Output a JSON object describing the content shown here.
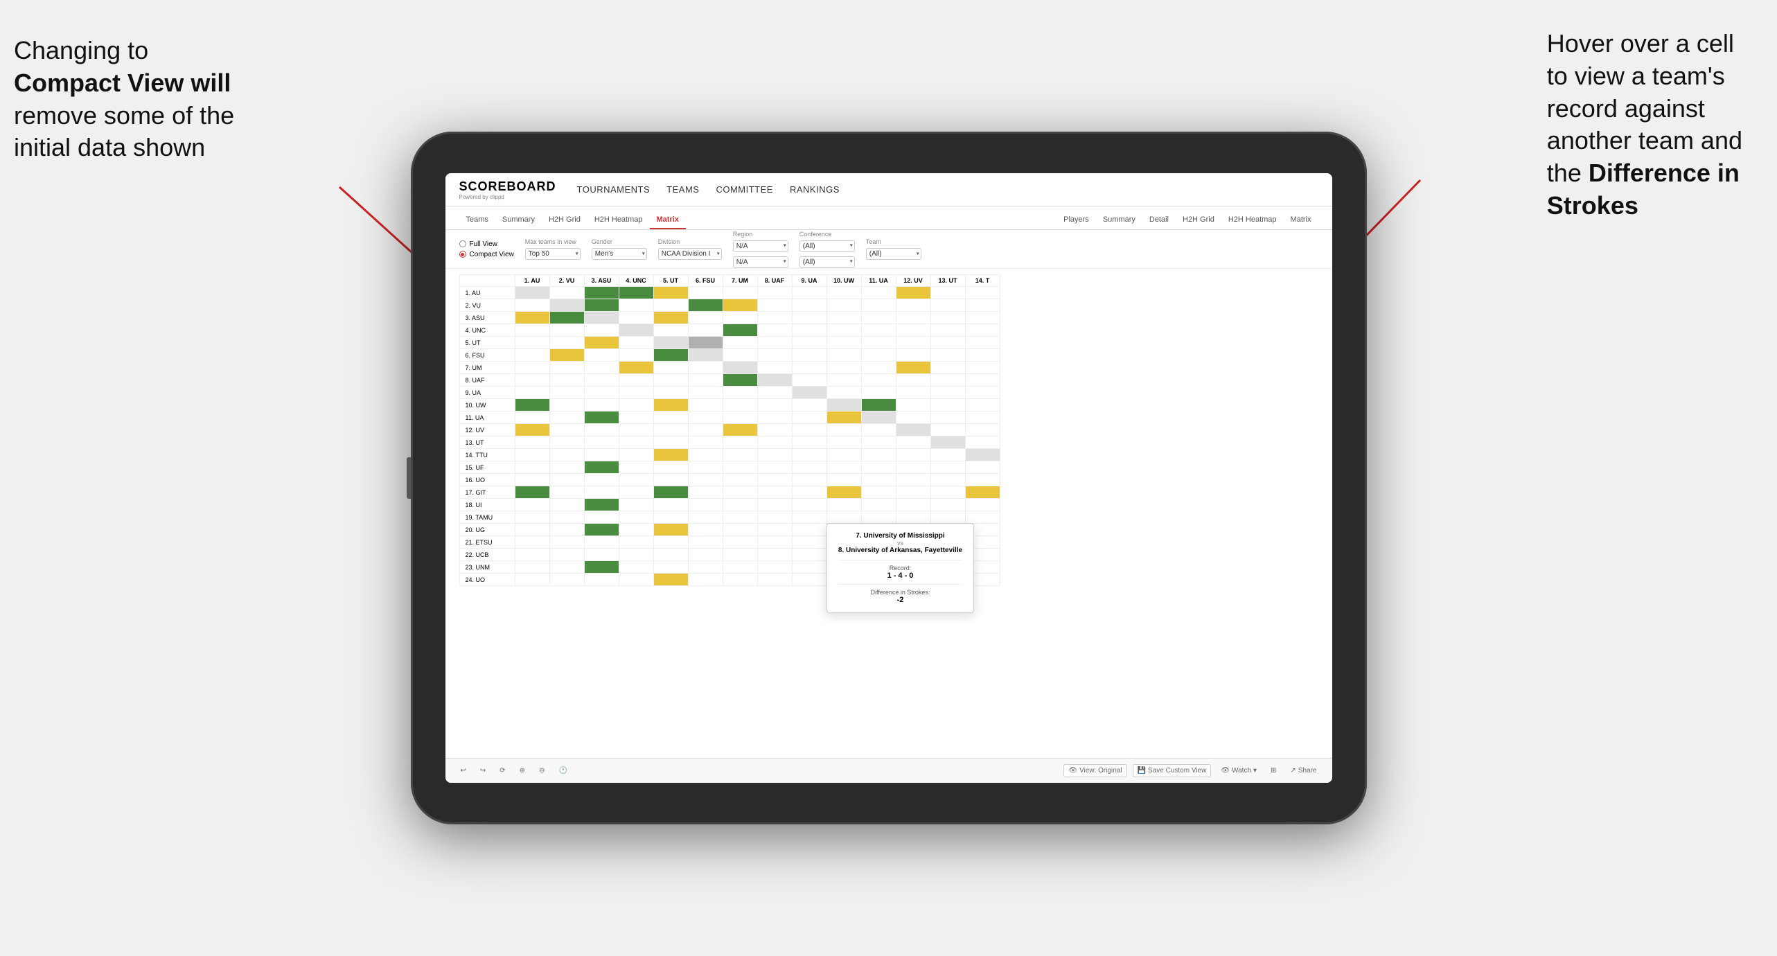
{
  "annotations": {
    "left": {
      "line1": "Changing to",
      "line2": "Compact View will",
      "line3": "remove some of the",
      "line4": "initial data shown"
    },
    "right": {
      "line1": "Hover over a cell",
      "line2": "to view a team's",
      "line3": "record against",
      "line4": "another team and",
      "line5": "the ",
      "line5bold": "Difference in",
      "line6": "Strokes"
    }
  },
  "app": {
    "logo": "SCOREBOARD",
    "logo_sub": "Powered by clippd",
    "nav": [
      "TOURNAMENTS",
      "TEAMS",
      "COMMITTEE",
      "RANKINGS"
    ]
  },
  "tabs_left": [
    "Teams",
    "Summary",
    "H2H Grid",
    "H2H Heatmap",
    "Matrix"
  ],
  "tabs_right": [
    "Players",
    "Summary",
    "Detail",
    "H2H Grid",
    "H2H Heatmap",
    "Matrix"
  ],
  "active_tab": "Matrix",
  "view_options": {
    "full_view": "Full View",
    "compact_view": "Compact View",
    "selected": "compact"
  },
  "filters": {
    "max_teams": {
      "label": "Max teams in view",
      "value": "Top 50"
    },
    "gender": {
      "label": "Gender",
      "value": "Men's"
    },
    "division": {
      "label": "Division",
      "value": "NCAA Division I"
    },
    "region": {
      "label": "Region",
      "value": "N/A",
      "value2": "N/A"
    },
    "conference": {
      "label": "Conference",
      "value": "(All)",
      "value2": "(All)"
    },
    "team": {
      "label": "Team",
      "value": "(All)"
    }
  },
  "col_headers": [
    "1. AU",
    "2. VU",
    "3. ASU",
    "4. UNC",
    "5. UT",
    "6. FSU",
    "7. UM",
    "8. UAF",
    "9. UA",
    "10. UW",
    "11. UA",
    "12. UV",
    "13. UT",
    "14. T"
  ],
  "rows": [
    {
      "label": "1. AU",
      "cells": [
        "diag",
        "white",
        "green",
        "green",
        "white",
        "white",
        "white",
        "white",
        "white",
        "white",
        "white",
        "white",
        "white",
        "white"
      ]
    },
    {
      "label": "2. VU",
      "cells": [
        "white",
        "diag",
        "green",
        "white",
        "white",
        "green",
        "white",
        "white",
        "white",
        "white",
        "white",
        "white",
        "white",
        "white"
      ]
    },
    {
      "label": "3. ASU",
      "cells": [
        "yellow",
        "green",
        "diag",
        "white",
        "yellow",
        "white",
        "white",
        "white",
        "white",
        "white",
        "white",
        "white",
        "white",
        "white"
      ]
    },
    {
      "label": "4. UNC",
      "cells": [
        "white",
        "white",
        "white",
        "diag",
        "white",
        "white",
        "green",
        "white",
        "white",
        "white",
        "white",
        "white",
        "white",
        "white"
      ]
    },
    {
      "label": "5. UT",
      "cells": [
        "white",
        "white",
        "yellow",
        "white",
        "diag",
        "gray",
        "white",
        "white",
        "white",
        "white",
        "white",
        "white",
        "white",
        "white"
      ]
    },
    {
      "label": "6. FSU",
      "cells": [
        "white",
        "yellow",
        "white",
        "white",
        "green",
        "diag",
        "white",
        "white",
        "white",
        "white",
        "white",
        "white",
        "white",
        "white"
      ]
    },
    {
      "label": "7. UM",
      "cells": [
        "white",
        "white",
        "white",
        "yellow",
        "white",
        "white",
        "diag",
        "white",
        "white",
        "white",
        "white",
        "white",
        "white",
        "white"
      ]
    },
    {
      "label": "8. UAF",
      "cells": [
        "white",
        "white",
        "white",
        "white",
        "white",
        "white",
        "white",
        "diag",
        "white",
        "white",
        "white",
        "white",
        "white",
        "white"
      ]
    },
    {
      "label": "9. UA",
      "cells": [
        "white",
        "white",
        "white",
        "white",
        "white",
        "white",
        "white",
        "white",
        "diag",
        "white",
        "white",
        "white",
        "white",
        "white"
      ]
    },
    {
      "label": "10. UW",
      "cells": [
        "green",
        "white",
        "white",
        "white",
        "yellow",
        "white",
        "white",
        "white",
        "white",
        "diag",
        "green",
        "white",
        "white",
        "white"
      ]
    },
    {
      "label": "11. UA",
      "cells": [
        "white",
        "white",
        "green",
        "white",
        "white",
        "white",
        "white",
        "white",
        "white",
        "yellow",
        "diag",
        "white",
        "white",
        "white"
      ]
    },
    {
      "label": "12. UV",
      "cells": [
        "white",
        "white",
        "white",
        "white",
        "white",
        "white",
        "white",
        "white",
        "white",
        "white",
        "white",
        "diag",
        "white",
        "white"
      ]
    },
    {
      "label": "13. UT",
      "cells": [
        "white",
        "white",
        "white",
        "white",
        "white",
        "white",
        "white",
        "white",
        "white",
        "white",
        "white",
        "white",
        "diag",
        "white"
      ]
    },
    {
      "label": "14. TTU",
      "cells": [
        "white",
        "white",
        "white",
        "white",
        "yellow",
        "white",
        "white",
        "white",
        "white",
        "white",
        "white",
        "white",
        "white",
        "diag"
      ]
    },
    {
      "label": "15. UF",
      "cells": [
        "white",
        "white",
        "green",
        "white",
        "white",
        "white",
        "white",
        "white",
        "white",
        "white",
        "white",
        "white",
        "white",
        "white"
      ]
    },
    {
      "label": "16. UO",
      "cells": [
        "white",
        "white",
        "white",
        "white",
        "white",
        "white",
        "white",
        "white",
        "white",
        "white",
        "white",
        "white",
        "white",
        "white"
      ]
    },
    {
      "label": "17. GIT",
      "cells": [
        "green",
        "white",
        "white",
        "white",
        "green",
        "white",
        "white",
        "white",
        "white",
        "yellow",
        "white",
        "white",
        "white",
        "white"
      ]
    },
    {
      "label": "18. UI",
      "cells": [
        "white",
        "white",
        "green",
        "white",
        "white",
        "white",
        "white",
        "white",
        "white",
        "white",
        "white",
        "white",
        "white",
        "white"
      ]
    },
    {
      "label": "19. TAMU",
      "cells": [
        "white",
        "white",
        "white",
        "white",
        "white",
        "white",
        "white",
        "white",
        "white",
        "white",
        "white",
        "white",
        "white",
        "white"
      ]
    },
    {
      "label": "20. UG",
      "cells": [
        "white",
        "white",
        "green",
        "white",
        "yellow",
        "white",
        "white",
        "white",
        "white",
        "green",
        "white",
        "white",
        "white",
        "white"
      ]
    },
    {
      "label": "21. ETSU",
      "cells": [
        "white",
        "white",
        "white",
        "white",
        "white",
        "white",
        "white",
        "white",
        "white",
        "white",
        "white",
        "white",
        "white",
        "white"
      ]
    },
    {
      "label": "22. UCB",
      "cells": [
        "white",
        "white",
        "white",
        "white",
        "white",
        "white",
        "white",
        "white",
        "white",
        "white",
        "white",
        "white",
        "white",
        "white"
      ]
    },
    {
      "label": "23. UNM",
      "cells": [
        "white",
        "white",
        "green",
        "white",
        "white",
        "white",
        "white",
        "white",
        "white",
        "white",
        "white",
        "white",
        "white",
        "white"
      ]
    },
    {
      "label": "24. UO",
      "cells": [
        "white",
        "white",
        "white",
        "white",
        "yellow",
        "white",
        "white",
        "white",
        "white",
        "white",
        "white",
        "white",
        "white",
        "white"
      ]
    }
  ],
  "tooltip": {
    "team1": "7. University of Mississippi",
    "vs": "vs",
    "team2": "8. University of Arkansas, Fayetteville",
    "record_label": "Record:",
    "record_value": "1 - 4 - 0",
    "diff_label": "Difference in Strokes:",
    "diff_value": "-2"
  },
  "toolbar": {
    "undo": "↩",
    "redo": "↪",
    "reset": "⟳",
    "view_original": "View: Original",
    "save_custom": "Save Custom View",
    "watch": "Watch",
    "share": "Share"
  }
}
